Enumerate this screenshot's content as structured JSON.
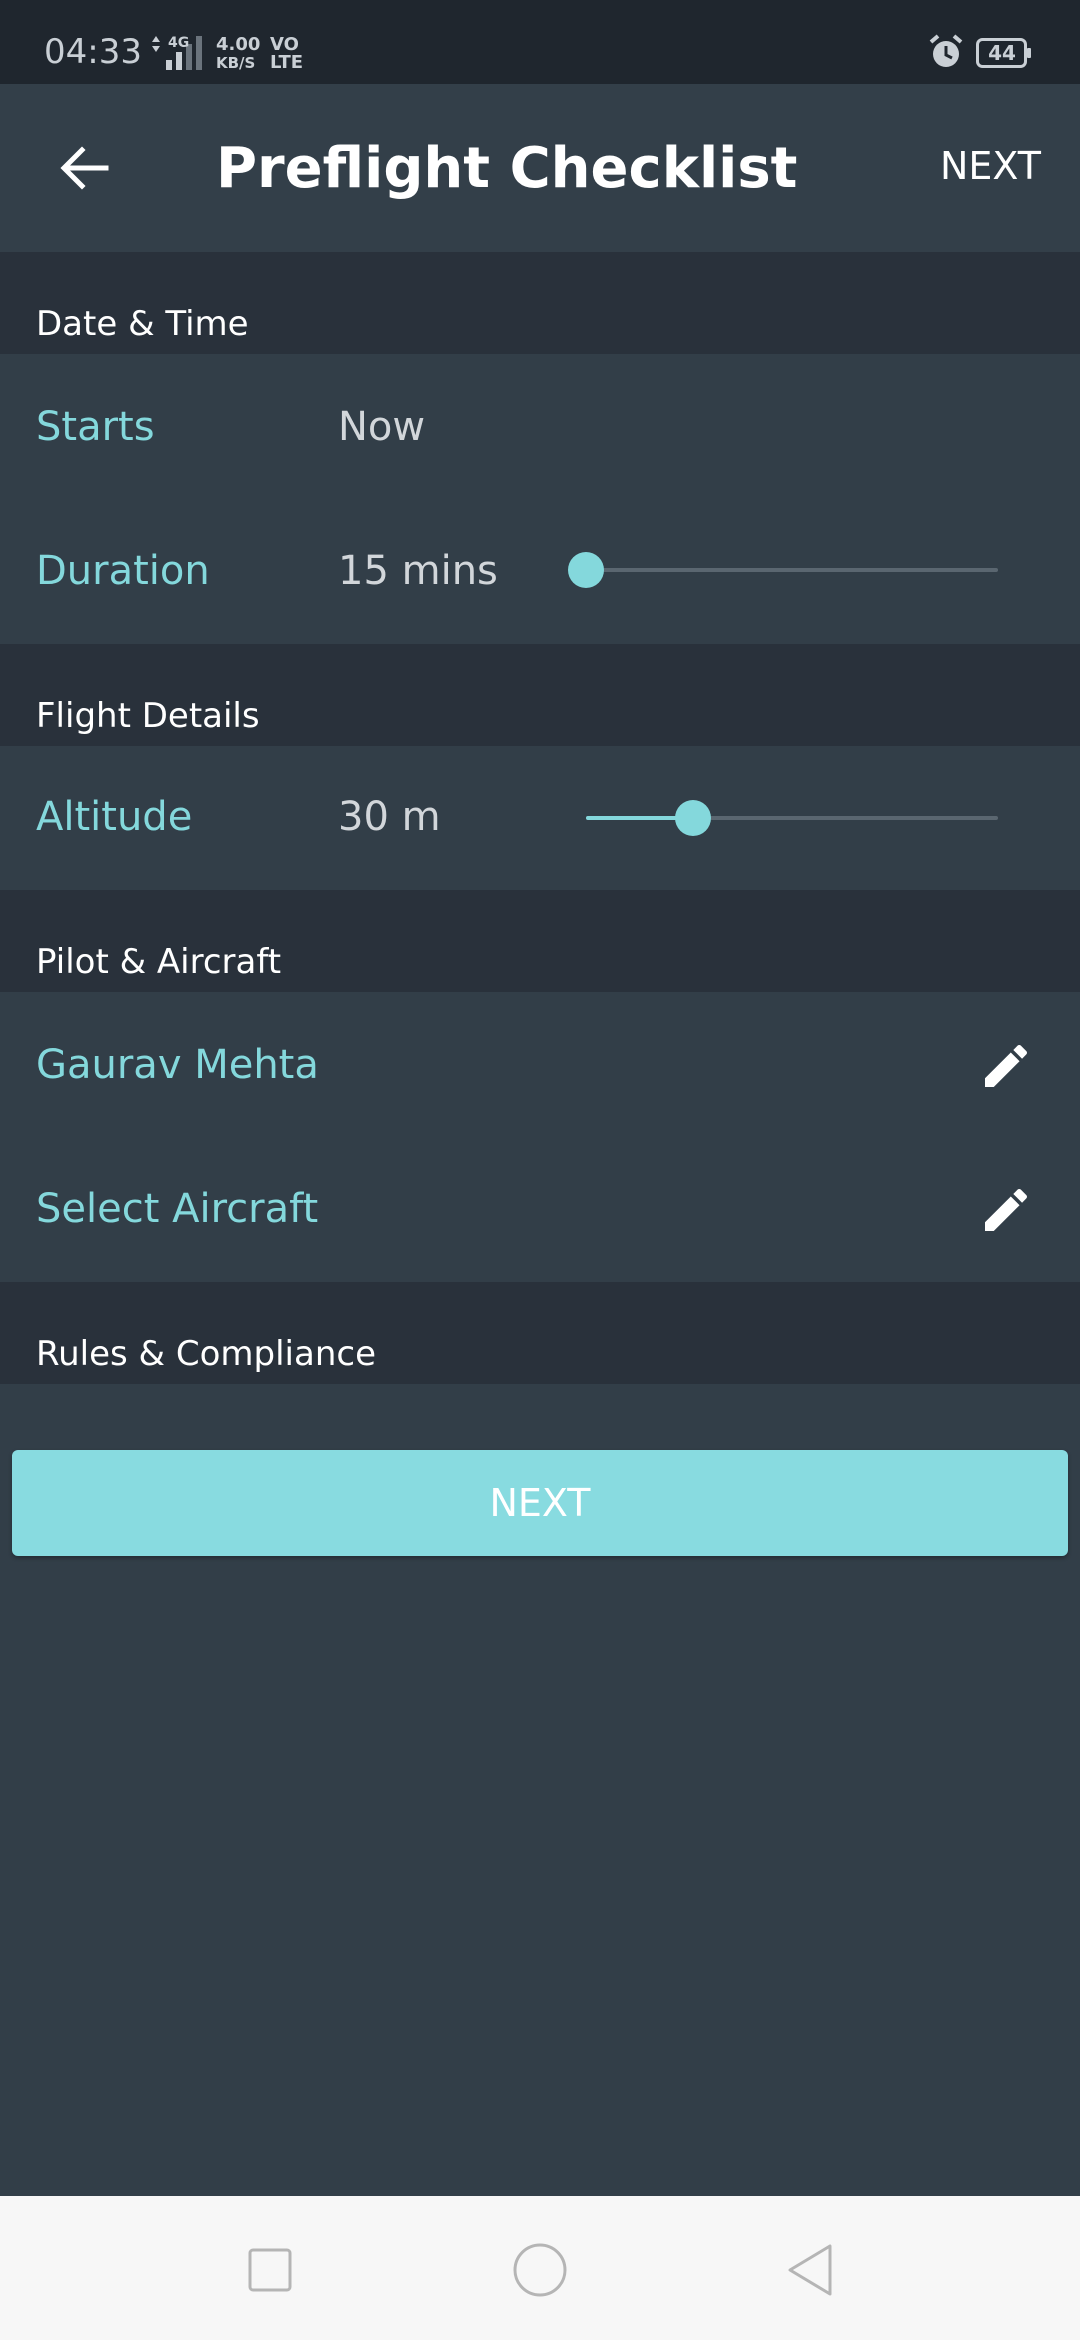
{
  "status_bar": {
    "time": "04:33",
    "network_type": "4G",
    "speed_value": "4.00",
    "speed_unit": "KB/S",
    "volte_top": "VO",
    "volte_bottom": "LTE",
    "battery_level": "44",
    "icons": [
      "signal-icon",
      "alarm-icon",
      "battery-icon"
    ]
  },
  "toolbar": {
    "title": "Preflight Checklist",
    "next_label": "NEXT",
    "back_icon": "arrow-back-icon"
  },
  "sections": {
    "date_time": {
      "header": "Date & Time",
      "starts_label": "Starts",
      "starts_value": "Now",
      "duration_label": "Duration",
      "duration_value": "15 mins",
      "duration_slider_fraction": 0.0
    },
    "flight_details": {
      "header": "Flight Details",
      "altitude_label": "Altitude",
      "altitude_value": "30 m",
      "altitude_slider_fraction": 0.26
    },
    "pilot_aircraft": {
      "header": "Pilot & Aircraft",
      "pilot_name": "Gaurav Mehta",
      "aircraft_label": "Select Aircraft",
      "edit_icon": "pencil-icon"
    },
    "rules_compliance": {
      "header": "Rules & Compliance"
    }
  },
  "next_button": {
    "label": "NEXT"
  },
  "nav_bar": {
    "icons": [
      "recents-square-icon",
      "home-circle-icon",
      "back-triangle-icon"
    ]
  },
  "colors": {
    "background": "#323e48",
    "section_header": "#29313b",
    "accent": "#84d8dc",
    "status_bar": "#1f262e",
    "nav_bar": "#f7f7f7"
  }
}
